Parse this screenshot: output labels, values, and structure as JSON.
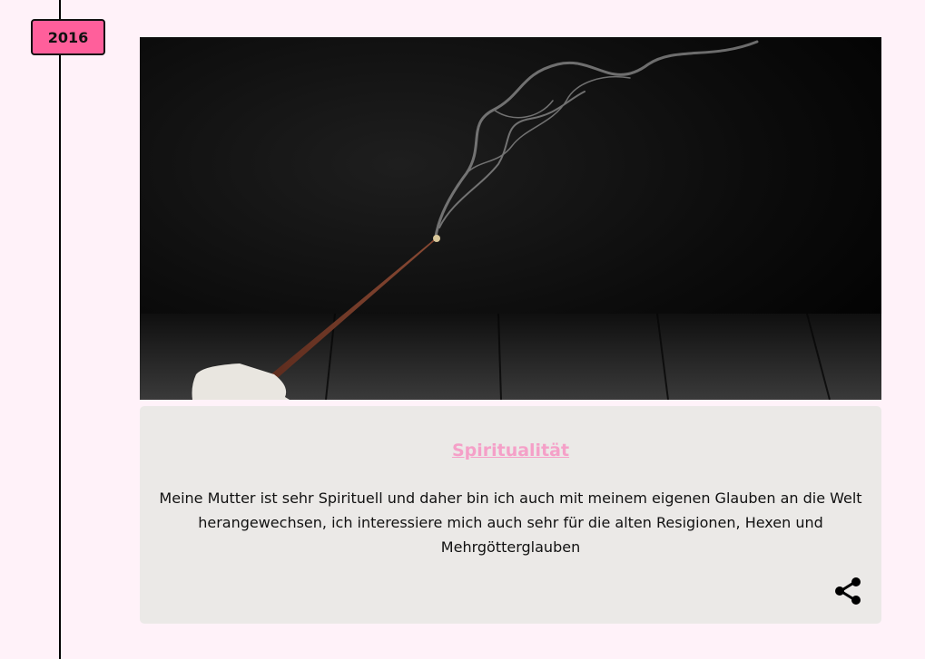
{
  "timeline": {
    "year": "2016"
  },
  "card": {
    "image_alt": "Räucherstäbchen mit Rauch",
    "title": "Spiritualität",
    "text": "Meine Mutter ist sehr Spirituell und daher bin ich auch mit meinem eigenen Glauben an die Welt herangewechsen, ich interessiere mich auch sehr für die alten Resigionen, Hexen und Mehrgötterglauben",
    "share_icon": "share-icon"
  },
  "colors": {
    "page_background": "#fff2f9",
    "badge": "#ff5f9b",
    "card_background": "#ebe9e7",
    "title_link": "#f5a0c8"
  }
}
